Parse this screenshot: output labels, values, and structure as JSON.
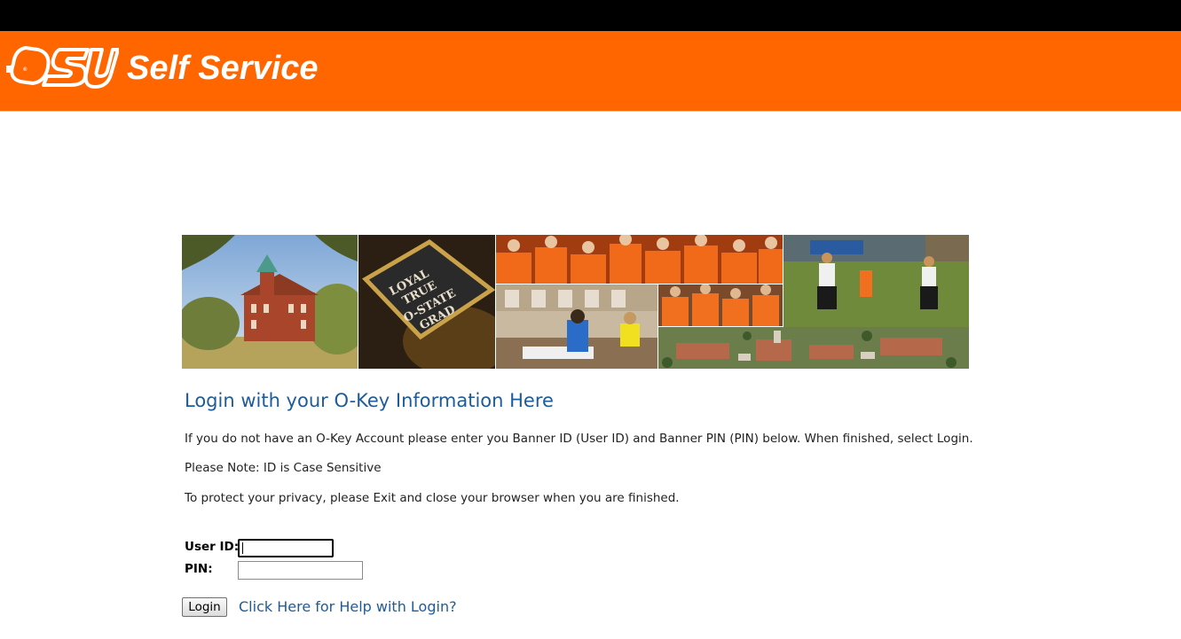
{
  "header": {
    "title": "Self Service",
    "brand_color": "#ff6600",
    "logo_alt": "OSU"
  },
  "banner": {
    "cap_text_lines": [
      "LOYAL",
      "TRUE",
      "O-STATE",
      "GRAD"
    ]
  },
  "login": {
    "heading": "Login with your O-Key Information Here",
    "instructions": "If you do not have an O-Key Account please enter you Banner ID (User ID) and Banner PIN (PIN) below. When finished, select Login.",
    "note": "Please Note: ID is Case Sensitive",
    "privacy": "To protect your privacy, please Exit and close your browser when you are finished.",
    "user_id_label": "User ID:",
    "pin_label": "PIN:",
    "user_id_value": "",
    "pin_value": "",
    "login_button": "Login",
    "help_link": "Click Here for Help with Login?"
  }
}
